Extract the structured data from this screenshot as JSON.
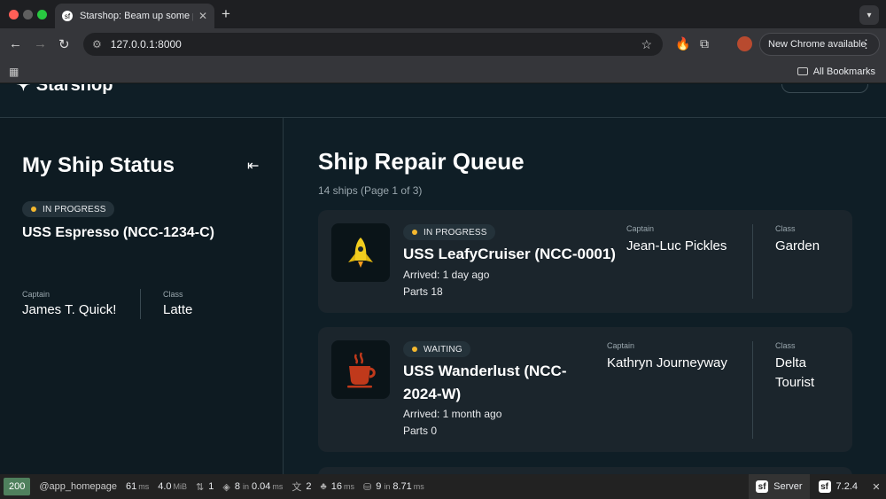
{
  "browser": {
    "tab_title": "Starshop: Beam up some parts",
    "tab_close": "✕",
    "new_tab": "+",
    "url": "127.0.0.1:8000",
    "update_label": "New Chrome available",
    "bookmarks_label": "All Bookmarks"
  },
  "site": {
    "logo_text": "Starshop"
  },
  "sidebar": {
    "title": "My Ship Status",
    "collapse": "⇤",
    "ship": {
      "status": "IN PROGRESS",
      "name": "USS Espresso (NCC-1234-C)",
      "captain_label": "Captain",
      "captain": "James T. Quick!",
      "class_label": "Class",
      "class": "Latte"
    }
  },
  "main": {
    "title": "Ship Repair Queue",
    "subtitle": "14 ships (Page 1 of 3)",
    "ships": [
      {
        "status": "IN PROGRESS",
        "name": "USS LeafyCruiser (NCC-0001)",
        "arrived": "Arrived: 1 day ago",
        "parts": "Parts 18",
        "captain_label": "Captain",
        "captain": "Jean-Luc Pickles",
        "class_label": "Class",
        "class": "Garden",
        "icon": "rocket-icon"
      },
      {
        "status": "WAITING",
        "name": "USS Wanderlust (NCC-2024-W)",
        "arrived": "Arrived: 1 month ago",
        "parts": "Parts 0",
        "captain_label": "Captain",
        "captain": "Kathryn Journeyway",
        "class_label": "Class",
        "class": "Delta Tourist",
        "icon": "coffee-cup-icon"
      }
    ]
  },
  "profiler": {
    "status_code": "200",
    "route": "@app_homepage",
    "time": "61",
    "time_unit": "ms",
    "memory": "4.0",
    "memory_unit": "MiB",
    "requests": "1",
    "cache_count": "8",
    "cache_in": "in",
    "cache_time": "0.04",
    "cache_unit": "ms",
    "translations": "2",
    "twig_time": "16",
    "twig_unit": "ms",
    "db_count": "9",
    "db_in": "in",
    "db_time": "8.71",
    "db_unit": "ms",
    "server": "Server",
    "version": "7.2.4",
    "close": "✕"
  },
  "colors": {
    "status_dot": "#f5b82e",
    "status_ok": "#4f805d",
    "page_bg": "#0f1e26",
    "card_bg": "#1b252c"
  }
}
